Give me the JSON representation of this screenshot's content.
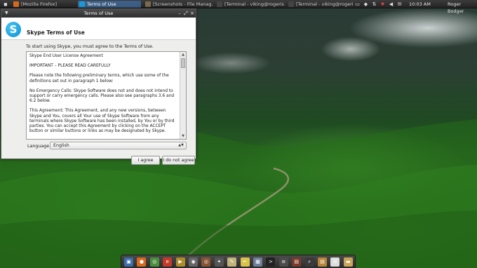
{
  "panel": {
    "tasks": [
      {
        "label": "[Mozilla Firefox]",
        "color": "#d46a1e",
        "active": false
      },
      {
        "label": "Terms of Use",
        "color": "#1a9bd7",
        "active": true
      },
      {
        "label": "[Screenshots - File Manag...",
        "color": "#7a6a4e",
        "active": false
      },
      {
        "label": "[Terminal - viking@rogeris...",
        "color": "#444444",
        "active": false
      },
      {
        "label": "[Terminal - viking@rogeris...",
        "color": "#444444",
        "active": false
      }
    ],
    "clock": "10:03 AM",
    "user": "Roger Bodger",
    "tray_icons": [
      "battery-icon",
      "shield-icon",
      "network-icon",
      "volume-icon",
      "mail-icon",
      "alert-icon",
      "update-icon"
    ]
  },
  "dialog": {
    "window_title": "Terms of Use",
    "header_title": "Skype Terms of Use",
    "logo_letter": "S",
    "intro": "To start using Skype, you must agree to the Terms of Use.",
    "eula": [
      "Skype End User License Agreement",
      "IMPORTANT – PLEASE READ CAREFULLY",
      "Please note the following preliminary terms, which use some of the definitions set out in paragraph 1 below:",
      "No Emergency Calls: Skype Software does not and does not intend to support or carry emergency calls. Please also see paragraphs 3.6 and 6.2 below.",
      "This Agreement: This Agreement, and any new versions, between Skype and You, covers all Your use of Skype Software from any terminals where Skype Software has been installed, by You or by third parties. You can accept this Agreement by clicking on the ACCEPT button or similar buttons or links as may be designated by Skype."
    ],
    "language_label": "Language",
    "language_value": "English",
    "agree_label": "I agree",
    "disagree_label": "I do not agree"
  },
  "dock": {
    "items": [
      {
        "icon": "image-viewer-icon",
        "color": "#3b6ea8",
        "glyph": "▣"
      },
      {
        "icon": "firefox-icon",
        "color": "#d9691c",
        "glyph": "●"
      },
      {
        "icon": "chrome-icon",
        "color": "#4a8f3c",
        "glyph": "◎"
      },
      {
        "icon": "browser-e-icon",
        "color": "#c43a2a",
        "glyph": "e"
      },
      {
        "icon": "media-icon",
        "color": "#b08b2a",
        "glyph": "▶"
      },
      {
        "icon": "disc-icon",
        "color": "#666666",
        "glyph": "◉"
      },
      {
        "icon": "webcam-icon",
        "color": "#885533",
        "glyph": "◎"
      },
      {
        "icon": "clapper-icon",
        "color": "#555555",
        "glyph": "✦"
      },
      {
        "icon": "editor-icon",
        "color": "#c2b37a",
        "glyph": "✎"
      },
      {
        "icon": "pencil-icon",
        "color": "#d8c24a",
        "glyph": "✏"
      },
      {
        "icon": "network-manager-icon",
        "color": "#6f7f9a",
        "glyph": "▦"
      },
      {
        "icon": "terminal-icon",
        "color": "#222222",
        "glyph": ">"
      },
      {
        "icon": "system-monitor-icon",
        "color": "#4b4b4b",
        "glyph": "≡"
      },
      {
        "icon": "task-manager-icon",
        "color": "#7a3a2a",
        "glyph": "▤"
      },
      {
        "icon": "search-icon",
        "color": "#3a3a3a",
        "glyph": "⌕"
      },
      {
        "icon": "archive-icon",
        "color": "#b8863b",
        "glyph": "▤"
      },
      {
        "icon": "document-icon",
        "color": "#dcdcdc",
        "glyph": "☰"
      },
      {
        "icon": "file-manager-icon",
        "color": "#c9a55a",
        "glyph": "▬"
      }
    ]
  }
}
